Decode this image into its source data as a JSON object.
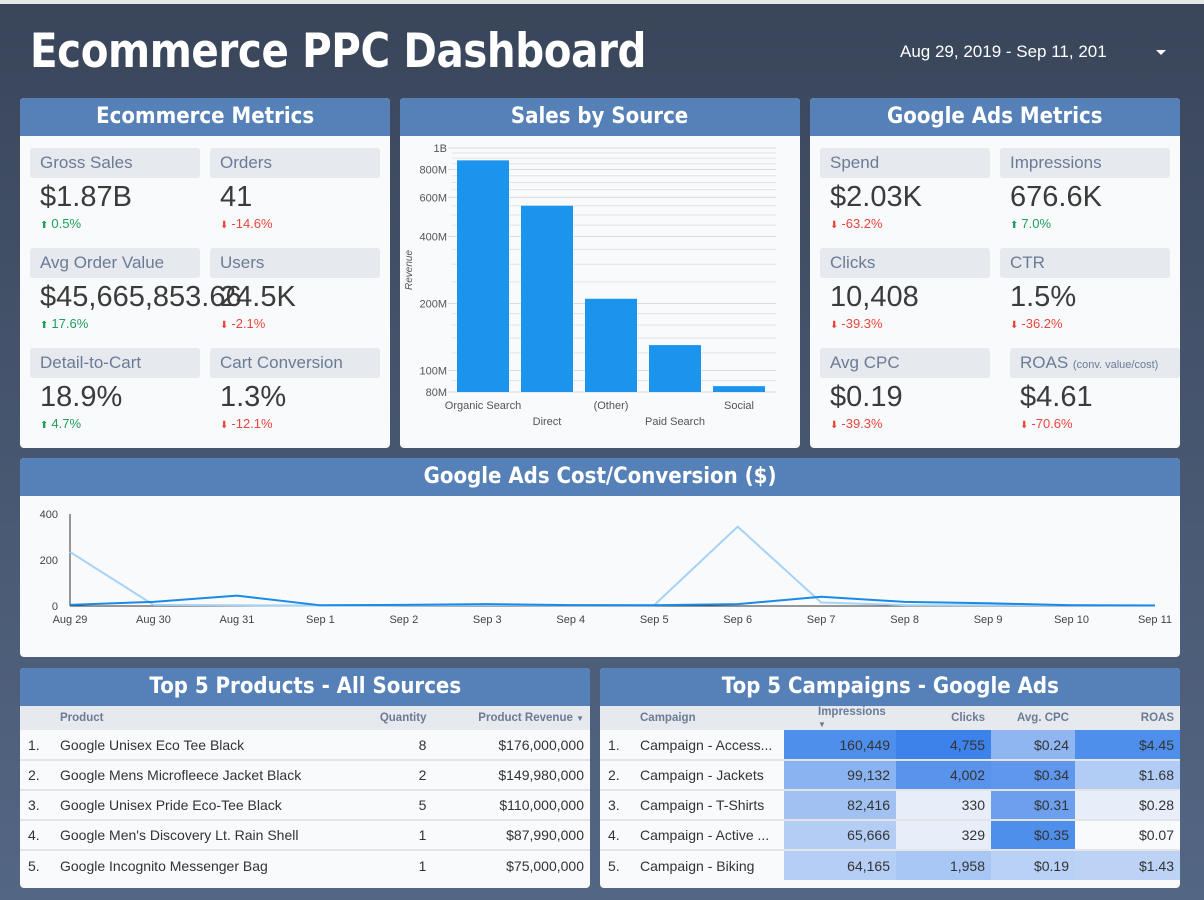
{
  "header": {
    "title": "Ecommerce PPC Dashboard",
    "date_range": "Aug 29, 2019 - Sep 11, 201",
    "date_dropdown_icon": "caret-down-icon"
  },
  "colors": {
    "panel_header": "#5581b8",
    "up": "#1e9e5a",
    "down": "#e8453c",
    "bar": "#1a94ec",
    "line_dark": "#1a8ae6",
    "line_light": "#a6d3f5"
  },
  "ecommerce": {
    "title": "Ecommerce Metrics",
    "metrics": [
      {
        "label": "Gross Sales",
        "value": "$1.87B",
        "delta": "0.5%",
        "dir": "up"
      },
      {
        "label": "Orders",
        "value": "41",
        "delta": "-14.6%",
        "dir": "down"
      },
      {
        "label": "Avg Order Value",
        "value": "$45,665,853.66",
        "delta": "17.6%",
        "dir": "up"
      },
      {
        "label": "Users",
        "value": "24.5K",
        "delta": "-2.1%",
        "dir": "down"
      },
      {
        "label": "Detail-to-Cart",
        "value": "18.9%",
        "delta": "4.7%",
        "dir": "up"
      },
      {
        "label": "Cart Conversion",
        "value": "1.3%",
        "delta": "-12.1%",
        "dir": "down"
      }
    ]
  },
  "google_ads": {
    "title": "Google Ads Metrics",
    "metrics": [
      {
        "label": "Spend",
        "value": "$2.03K",
        "delta": "-63.2%",
        "dir": "down"
      },
      {
        "label": "Impressions",
        "value": "676.6K",
        "delta": "7.0%",
        "dir": "up"
      },
      {
        "label": "Clicks",
        "value": "10,408",
        "delta": "-39.3%",
        "dir": "down"
      },
      {
        "label": "CTR",
        "value": "1.5%",
        "delta": "-36.2%",
        "dir": "down"
      },
      {
        "label": "Avg CPC",
        "value": "$0.19",
        "delta": "-39.3%",
        "dir": "down"
      },
      {
        "label": "ROAS",
        "label_note": "(conv. value/cost)",
        "value": "$4.61",
        "delta": "-70.6%",
        "dir": "down"
      }
    ]
  },
  "sales_panel": {
    "title": "Sales by Source"
  },
  "cost_panel": {
    "title": "Google Ads  Cost/Conversion ($)"
  },
  "chart_data": [
    {
      "type": "bar",
      "title": "Sales by Source",
      "categories": [
        "Organic Search",
        "Direct",
        "(Other)",
        "Paid Search",
        "Social"
      ],
      "values": [
        880000000,
        550000000,
        210000000,
        130000000,
        85000000
      ],
      "xlabel": "",
      "ylabel": "Revenue",
      "yscale": "log",
      "ylim": [
        80000000,
        1000000000
      ],
      "yticks": [
        {
          "v": 80000000,
          "label": "80M"
        },
        {
          "v": 100000000,
          "label": "100M"
        },
        {
          "v": 200000000,
          "label": "200M"
        },
        {
          "v": 400000000,
          "label": "400M"
        },
        {
          "v": 600000000,
          "label": "600M"
        },
        {
          "v": 800000000,
          "label": "800M"
        },
        {
          "v": 1000000000,
          "label": "1B"
        }
      ],
      "grid": true
    },
    {
      "type": "line",
      "title": "Google Ads  Cost/Conversion ($)",
      "x": [
        "Aug 29",
        "Aug 30",
        "Aug 31",
        "Sep 1",
        "Sep 2",
        "Sep 3",
        "Sep 4",
        "Sep 5",
        "Sep 6",
        "Sep 7",
        "Sep 8",
        "Sep 9",
        "Sep 10",
        "Sep 11"
      ],
      "series": [
        {
          "name": "series-light",
          "values": [
            235,
            5,
            3,
            2,
            3,
            4,
            3,
            4,
            345,
            15,
            4,
            3,
            3,
            3
          ]
        },
        {
          "name": "series-dark",
          "values": [
            5,
            18,
            45,
            3,
            5,
            8,
            4,
            3,
            8,
            40,
            18,
            12,
            3,
            2
          ]
        }
      ],
      "ylim": [
        0,
        400
      ],
      "yticks": [
        0,
        200,
        400
      ],
      "grid": false
    }
  ],
  "products": {
    "title": "Top 5 Products - All Sources",
    "columns": [
      "Product",
      "Quantity",
      "Product Revenue"
    ],
    "sort_icon": "sort-desc-icon",
    "rows": [
      {
        "idx": "1.",
        "product": "Google Unisex Eco Tee Black",
        "qty": "8",
        "revenue": "$176,000,000"
      },
      {
        "idx": "2.",
        "product": "Google Mens Microfleece Jacket Black",
        "qty": "2",
        "revenue": "$149,980,000"
      },
      {
        "idx": "3.",
        "product": "Google Unisex Pride Eco-Tee Black",
        "qty": "5",
        "revenue": "$110,000,000"
      },
      {
        "idx": "4.",
        "product": "Google Men's Discovery Lt. Rain Shell",
        "qty": "1",
        "revenue": "$87,990,000"
      },
      {
        "idx": "5.",
        "product": "Google Incognito Messenger Bag",
        "qty": "1",
        "revenue": "$75,000,000"
      }
    ]
  },
  "campaigns": {
    "title": "Top 5 Campaigns - Google Ads",
    "columns": [
      "Campaign",
      "Impressions",
      "Clicks",
      "Avg. CPC",
      "ROAS"
    ],
    "rows": [
      {
        "idx": "1.",
        "campaign": "Campaign - Access...",
        "impressions": "160,449",
        "clicks": "4,755",
        "cpc": "$0.24",
        "roas": "$4.45",
        "heat": [
          "#4f8fec",
          "#3d82ea",
          "#8fb6f1",
          "#4f8fec"
        ]
      },
      {
        "idx": "2.",
        "campaign": "Campaign - Jackets",
        "impressions": "99,132",
        "clicks": "4,002",
        "cpc": "$0.34",
        "roas": "$1.68",
        "heat": [
          "#8ab3f1",
          "#5993ec",
          "#5e97ed",
          "#b1ccf5"
        ]
      },
      {
        "idx": "3.",
        "campaign": "Campaign - T-Shirts",
        "impressions": "82,416",
        "clicks": "330",
        "cpc": "$0.31",
        "roas": "$0.28",
        "heat": [
          "#a1c1f3",
          "#e7eefa",
          "#6c9fee",
          "#e7eefa"
        ]
      },
      {
        "idx": "4.",
        "campaign": "Campaign - Active ...",
        "impressions": "65,666",
        "clicks": "329",
        "cpc": "$0.35",
        "roas": "$0.07",
        "heat": [
          "#b3cdf5",
          "#e7eefa",
          "#4f8fec",
          "#f9fafb"
        ]
      },
      {
        "idx": "5.",
        "campaign": "Campaign - Biking",
        "impressions": "64,165",
        "clicks": "1,958",
        "cpc": "$0.19",
        "roas": "$1.43",
        "heat": [
          "#b5cef5",
          "#a9c7f4",
          "#b9d1f6",
          "#bcd3f6"
        ]
      }
    ]
  }
}
